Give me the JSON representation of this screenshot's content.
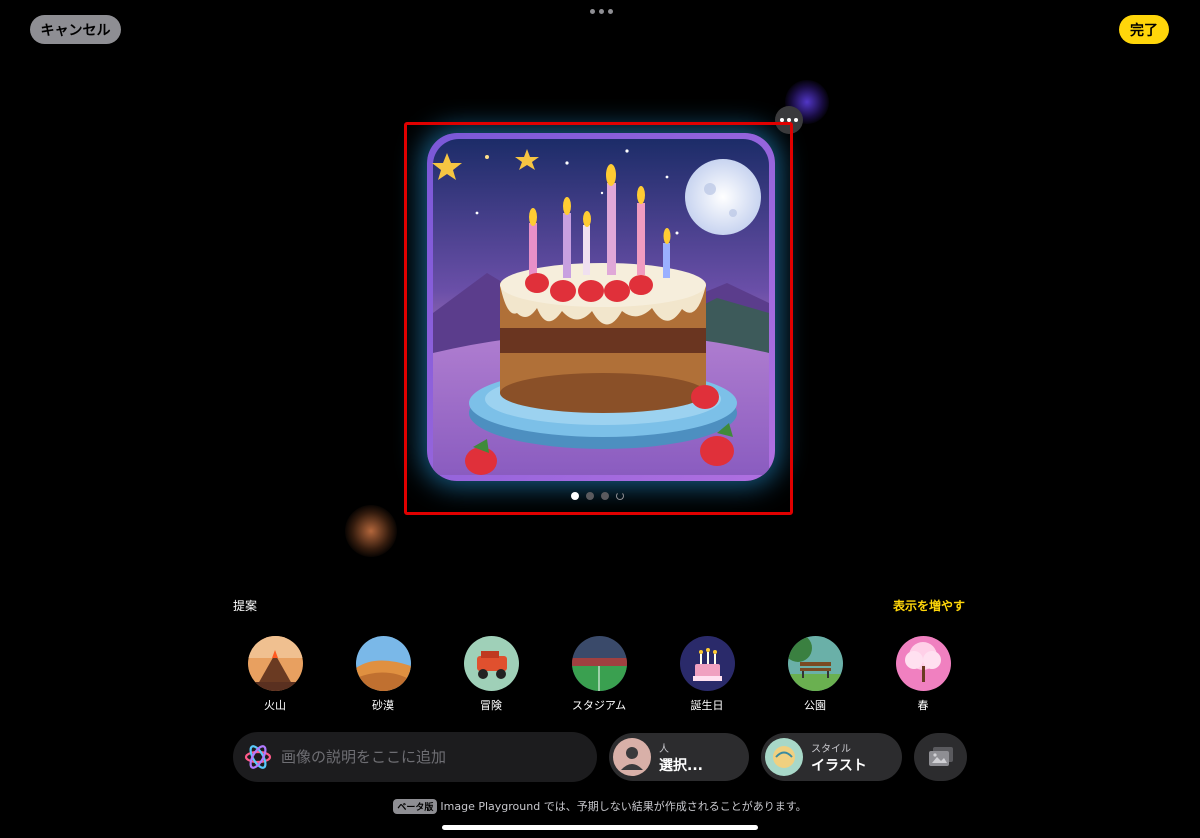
{
  "header": {
    "cancel_label": "キャンセル",
    "done_label": "完了"
  },
  "preview": {
    "image_subject": "birthday cake with candles and strawberries",
    "page_count": 4,
    "active_page": 1
  },
  "suggestions": {
    "title": "提案",
    "more_label": "表示を増やす",
    "items": [
      {
        "label": "火山",
        "icon": "volcano-thumbnail"
      },
      {
        "label": "砂漠",
        "icon": "desert-thumbnail"
      },
      {
        "label": "冒険",
        "icon": "adventure-thumbnail"
      },
      {
        "label": "スタジアム",
        "icon": "stadium-thumbnail"
      },
      {
        "label": "誕生日",
        "icon": "birthday-thumbnail"
      },
      {
        "label": "公園",
        "icon": "park-thumbnail"
      },
      {
        "label": "春",
        "icon": "spring-thumbnail"
      }
    ]
  },
  "prompt": {
    "placeholder": "画像の説明をここに追加"
  },
  "person": {
    "small_label": "人",
    "value": "選択..."
  },
  "style": {
    "small_label": "スタイル",
    "value": "イラスト"
  },
  "footer": {
    "beta_badge": "ベータ版",
    "note": "Image Playground では、予期しない結果が作成されることがあります。"
  },
  "colors": {
    "accent": "#ffd60a",
    "highlight": "#e00000",
    "glow": "#28a0e6"
  }
}
